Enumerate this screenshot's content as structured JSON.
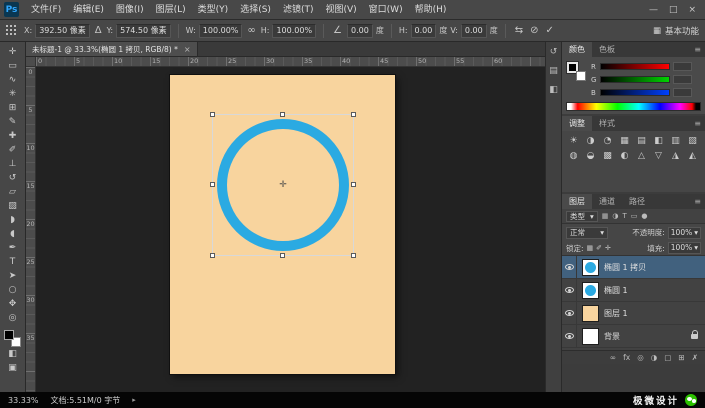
{
  "colors": {
    "accent_blue": "#2BAAE2",
    "doc_peach": "#F8D49E",
    "selected_row": "#41617E",
    "wechat_green": "#2DC100"
  },
  "menu_bar": {
    "logo": "Ps",
    "items": [
      "文件(F)",
      "编辑(E)",
      "图像(I)",
      "图层(L)",
      "类型(Y)",
      "选择(S)",
      "滤镜(T)",
      "视图(V)",
      "窗口(W)",
      "帮助(H)"
    ],
    "minimize": "—",
    "maximize": "□",
    "close": "×"
  },
  "options_bar": {
    "x_label": "X:",
    "x_value": "392.50 像素",
    "delta_icon": "Δ",
    "y_label": "Y:",
    "y_value": "574.50 像素",
    "w_label": "W:",
    "w_value": "100.00%",
    "link_icon": "∞",
    "h_label": "H:",
    "h_value": "100.00%",
    "angle_icon": "∠",
    "angle_value": "0.00",
    "angle_unit": "度",
    "hskew_label": "H:",
    "hskew_value": "0.00",
    "hskew_unit": "度",
    "vskew_label": "V:",
    "vskew_value": "0.00",
    "vskew_unit": "度",
    "warp_icon": "⇆",
    "cancel_icon": "⊘",
    "commit_icon": "✓",
    "workspace_icon": "▦",
    "workspace": "基本功能"
  },
  "document_tab": {
    "title": "未标题-1 @ 33.3%(椭圆 1 拷贝, RGB/8) *",
    "close": "×"
  },
  "toolbar": {
    "tools": [
      {
        "name": "move-tool",
        "glyph": "✛"
      },
      {
        "name": "marquee-tool",
        "glyph": "▭"
      },
      {
        "name": "lasso-tool",
        "glyph": "∿"
      },
      {
        "name": "quick-selection-tool",
        "glyph": "✳"
      },
      {
        "name": "crop-tool",
        "glyph": "⊞"
      },
      {
        "name": "eyedropper-tool",
        "glyph": "✎"
      },
      {
        "name": "healing-brush-tool",
        "glyph": "✚"
      },
      {
        "name": "brush-tool",
        "glyph": "✐"
      },
      {
        "name": "clone-stamp-tool",
        "glyph": "⊥"
      },
      {
        "name": "history-brush-tool",
        "glyph": "↺"
      },
      {
        "name": "eraser-tool",
        "glyph": "▱"
      },
      {
        "name": "gradient-tool",
        "glyph": "▨"
      },
      {
        "name": "blur-tool",
        "glyph": "◗"
      },
      {
        "name": "dodge-tool",
        "glyph": "◖"
      },
      {
        "name": "pen-tool",
        "glyph": "✒"
      },
      {
        "name": "type-tool",
        "glyph": "T"
      },
      {
        "name": "path-selection-tool",
        "glyph": "➤"
      },
      {
        "name": "ellipse-shape-tool",
        "glyph": "○"
      },
      {
        "name": "hand-tool",
        "glyph": "✥"
      },
      {
        "name": "zoom-tool",
        "glyph": "◎"
      }
    ],
    "quickmask_glyph": "◧",
    "screenmode_glyph": "▣"
  },
  "rulers": {
    "top": [
      "0",
      "5",
      "10",
      "15",
      "20",
      "25",
      "30",
      "35",
      "40",
      "45",
      "50",
      "55",
      "60"
    ],
    "left": [
      "0",
      "5",
      "10",
      "15",
      "20",
      "25",
      "30",
      "35"
    ]
  },
  "dock_strip": [
    {
      "name": "history-panel-icon",
      "glyph": "↺"
    },
    {
      "name": "properties-panel-icon",
      "glyph": "▤"
    },
    {
      "name": "info-panel-icon",
      "glyph": "◧"
    }
  ],
  "color_panel": {
    "tab_color": "颜色",
    "tab_swatches": "色板",
    "menu_icon": "≡",
    "sliders": [
      "R",
      "G",
      "B"
    ]
  },
  "adjustments_panel": {
    "tab_adjustments": "调整",
    "tab_styles": "样式",
    "menu_icon": "≡",
    "icons": [
      "☀",
      "◑",
      "◔",
      "▦",
      "▤",
      "◧",
      "▥",
      "▧",
      "◍",
      "◒",
      "▩",
      "◐",
      "△",
      "▽",
      "◮",
      "◭"
    ]
  },
  "layers_panel": {
    "tab_layers": "图层",
    "tab_channels": "通道",
    "tab_paths": "路径",
    "menu_icon": "≡",
    "filter_label": "类型",
    "filter_caret": "▾",
    "filter_icons": [
      "▦",
      "◑",
      "T",
      "▭",
      "●"
    ],
    "blend_mode": "正常",
    "blend_caret": "▾",
    "opacity_label": "不透明度:",
    "opacity_value": "100%",
    "lock_label": "锁定:",
    "lock_icons": [
      "▦",
      "✐",
      "✛"
    ],
    "fill_label": "填充:",
    "fill_value": "100%",
    "layers": [
      {
        "name": "椭圆 1 拷贝"
      },
      {
        "name": "椭圆 1"
      },
      {
        "name": "图层 1"
      },
      {
        "name": "背景"
      }
    ],
    "bottom_icons": [
      {
        "name": "link-layers-icon",
        "glyph": "∞"
      },
      {
        "name": "layer-style-icon",
        "glyph": "fx"
      },
      {
        "name": "layer-mask-icon",
        "glyph": "◎"
      },
      {
        "name": "adjustment-layer-icon",
        "glyph": "◑"
      },
      {
        "name": "layer-group-icon",
        "glyph": "▢"
      },
      {
        "name": "new-layer-icon",
        "glyph": "⊞"
      },
      {
        "name": "delete-layer-icon",
        "glyph": "✗"
      }
    ]
  },
  "status_bar": {
    "zoom": "33.33%",
    "doc_info": "文档:5.51M/0 字节",
    "expander": "▸"
  },
  "brand": {
    "text": "极微设计"
  }
}
